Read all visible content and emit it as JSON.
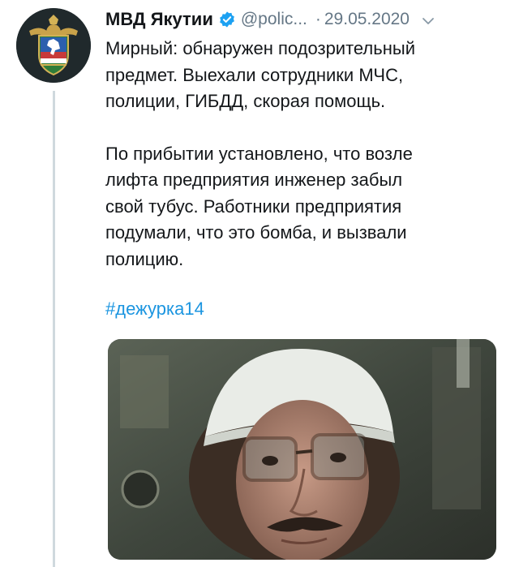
{
  "author": {
    "name": "МВД Якутии",
    "handle": "@polic...",
    "date_separator": "·",
    "date": "29.05.2020",
    "avatar_icon": "police-emblem-icon",
    "verified_icon": "verified-badge-icon"
  },
  "tweet": {
    "paragraph_1": "Мирный: обнаружен подозрительный\nпредмет. Выехали сотрудники МЧС,\nполиции, ГИБДД, скорая помощь.",
    "paragraph_2": "По прибытии установлено, что возле\nлифта предприятия инженер забыл\nсвой тубус. Работники предприятия\nподумали, что это бомба, и вызвали\nполицию.",
    "hashtag": "#дежурка14"
  },
  "colors": {
    "text": "#14171a",
    "secondary": "#657786",
    "link": "#1b95e0",
    "verified": "#1da1f2",
    "thread_line": "#cfd9de"
  },
  "icons": {
    "menu": "chevron-down-icon"
  }
}
